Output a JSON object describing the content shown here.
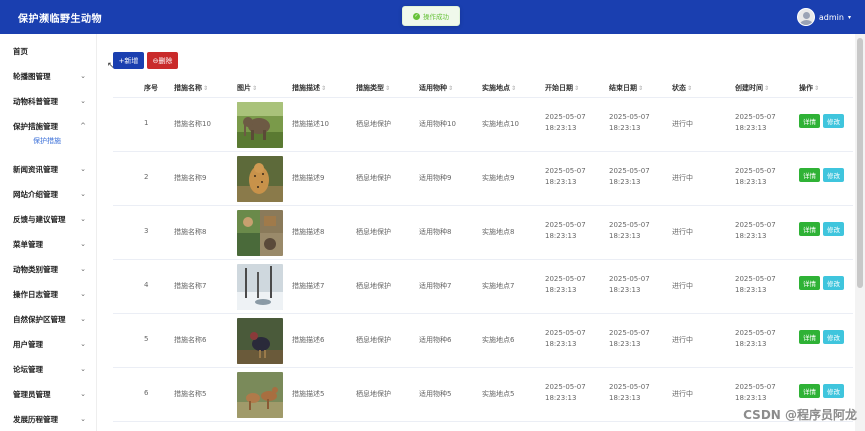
{
  "app": {
    "title": "保护濒临野生动物"
  },
  "user": {
    "name": "admin",
    "caret": "▾"
  },
  "toast": {
    "message": "操作成功",
    "icon": "success-check-icon"
  },
  "sidebar": {
    "items": [
      {
        "label": "首页",
        "has_chevron": false
      },
      {
        "label": "轮播图管理",
        "has_chevron": true
      },
      {
        "label": "动物科普管理",
        "has_chevron": true
      },
      {
        "label": "保护措施管理",
        "has_chevron": true,
        "expanded": true,
        "children": [
          "保护措施"
        ]
      },
      {
        "label": "新闻资讯管理",
        "has_chevron": true
      },
      {
        "label": "网站介绍管理",
        "has_chevron": true
      },
      {
        "label": "反馈与建议管理",
        "has_chevron": true
      },
      {
        "label": "菜单管理",
        "has_chevron": true
      },
      {
        "label": "动物类别管理",
        "has_chevron": true
      },
      {
        "label": "操作日志管理",
        "has_chevron": true
      },
      {
        "label": "自然保护区管理",
        "has_chevron": true
      },
      {
        "label": "用户管理",
        "has_chevron": true
      },
      {
        "label": "论坛管理",
        "has_chevron": true
      },
      {
        "label": "管理员管理",
        "has_chevron": true
      },
      {
        "label": "发展历程管理",
        "has_chevron": true
      }
    ],
    "chevron_down": "⌄",
    "chevron_up": "^"
  },
  "toolbar": {
    "add_label": "+新增",
    "delete_label": "⊖删除"
  },
  "table": {
    "columns": [
      "序号",
      "措施名称",
      "图片",
      "措施描述",
      "措施类型",
      "适用物种",
      "实施地点",
      "开始日期",
      "结束日期",
      "状态",
      "创建时间",
      "操作"
    ],
    "sortable": [
      false,
      true,
      true,
      true,
      true,
      true,
      true,
      true,
      true,
      true,
      true,
      true
    ],
    "sort_glyph": "⇕",
    "rows": [
      {
        "index": "1",
        "name": "措施名称10",
        "desc": "措施描述10",
        "type": "栖息地保护",
        "species": "适用物种10",
        "place": "实施地点10",
        "start": "2025-05-07 18:23:13",
        "end": "2025-05-07 18:23:13",
        "status": "进行中",
        "created": "2025-05-07 18:23:13",
        "image": "elephant"
      },
      {
        "index": "2",
        "name": "措施名称9",
        "desc": "措施描述9",
        "type": "栖息地保护",
        "species": "适用物种9",
        "place": "实施地点9",
        "start": "2025-05-07 18:23:13",
        "end": "2025-05-07 18:23:13",
        "status": "进行中",
        "created": "2025-05-07 18:23:13",
        "image": "cheetah"
      },
      {
        "index": "3",
        "name": "措施名称8",
        "desc": "措施描述8",
        "type": "栖息地保护",
        "species": "适用物种8",
        "place": "实施地点8",
        "start": "2025-05-07 18:23:13",
        "end": "2025-05-07 18:23:13",
        "status": "进行中",
        "created": "2025-05-07 18:23:13",
        "image": "collage"
      },
      {
        "index": "4",
        "name": "措施名称7",
        "desc": "措施描述7",
        "type": "栖息地保护",
        "species": "适用物种7",
        "place": "实施地点7",
        "start": "2025-05-07 18:23:13",
        "end": "2025-05-07 18:23:13",
        "status": "进行中",
        "created": "2025-05-07 18:23:13",
        "image": "snow"
      },
      {
        "index": "5",
        "name": "措施名称6",
        "desc": "措施描述6",
        "type": "栖息地保护",
        "species": "适用物种6",
        "place": "实施地点6",
        "start": "2025-05-07 18:23:13",
        "end": "2025-05-07 18:23:13",
        "status": "进行中",
        "created": "2025-05-07 18:23:13",
        "image": "bird"
      },
      {
        "index": "6",
        "name": "措施名称5",
        "desc": "措施描述5",
        "type": "栖息地保护",
        "species": "适用物种5",
        "place": "实施地点5",
        "start": "2025-05-07 18:23:13",
        "end": "2025-05-07 18:23:13",
        "status": "进行中",
        "created": "2025-05-07 18:23:13",
        "image": "deer"
      }
    ],
    "detail_label": "详情",
    "edit_label": "修改"
  },
  "watermark": "CSDN @程序员阿龙",
  "colors": {
    "header": "#1a3fb0",
    "delete": "#c92a2a",
    "detail": "#2fb236",
    "edit": "#3fc5dd",
    "submenu": "#3a6fd8"
  }
}
